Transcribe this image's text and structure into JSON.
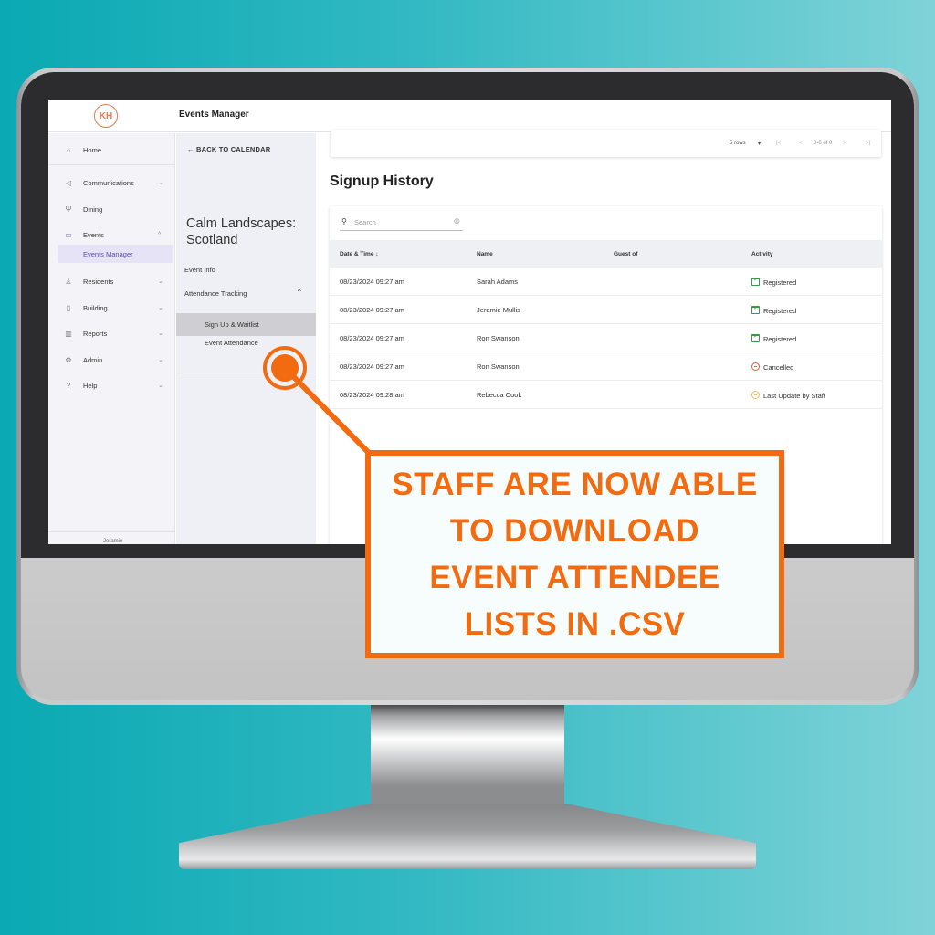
{
  "app": {
    "logo_text": "KH",
    "title": "Events Manager",
    "accent_color": "#5a4bb0",
    "logo_color": "#e47a4f"
  },
  "sidebar": {
    "items": [
      {
        "label": "Home",
        "icon": "home-icon",
        "glyph": "⌂",
        "chevron": ""
      },
      {
        "label": "Communications",
        "icon": "megaphone-icon",
        "glyph": "◁",
        "chevron": "⌄"
      },
      {
        "label": "Dining",
        "icon": "utensils-icon",
        "glyph": "Ψ",
        "chevron": ""
      },
      {
        "label": "Events",
        "icon": "calendar-icon",
        "glyph": "▭",
        "chevron": "^"
      },
      {
        "label": "Residents",
        "icon": "person-icon",
        "glyph": "♙",
        "chevron": "⌄"
      },
      {
        "label": "Building",
        "icon": "building-icon",
        "glyph": "▯",
        "chevron": "⌄"
      },
      {
        "label": "Reports",
        "icon": "bar-chart-icon",
        "glyph": "▥",
        "chevron": "⌄"
      },
      {
        "label": "Admin",
        "icon": "gear-icon",
        "glyph": "⚙",
        "chevron": "⌄"
      },
      {
        "label": "Help",
        "icon": "help-icon",
        "glyph": "?",
        "chevron": "⌄"
      }
    ],
    "sub_item": "Events Manager",
    "user_label": "Jeramie"
  },
  "subpanel": {
    "back_label": "← BACK TO CALENDAR",
    "event_title": "Calm Landscapes: Scotland",
    "event_info": "Event Info",
    "attendance_tracking": "Attendance Tracking",
    "attendance_chevron": "^",
    "signup_waitlist": "Sign Up & Waitlist",
    "event_attendance": "Event Attendance"
  },
  "pager": {
    "rows_label": "5 rows",
    "dropdown": "▾",
    "first": "|<",
    "prev": "<",
    "range": "0-0 of 0",
    "next": ">",
    "last": ">|"
  },
  "signup_history": {
    "title": "Signup History",
    "search_placeholder": "Search",
    "columns": [
      "Date & Time ↓",
      "Name",
      "Guest of",
      "Activity"
    ],
    "rows": [
      {
        "datetime": "08/23/2024 09:27 am",
        "name": "Sarah Adams",
        "guest_of": "",
        "activity": "Registered",
        "activity_type": "registered"
      },
      {
        "datetime": "08/23/2024 09:27 am",
        "name": "Jeramie Mullis",
        "guest_of": "",
        "activity": "Registered",
        "activity_type": "registered"
      },
      {
        "datetime": "08/23/2024 09:27 am",
        "name": "Ron Swanson",
        "guest_of": "",
        "activity": "Registered",
        "activity_type": "registered"
      },
      {
        "datetime": "08/23/2024 09:27 am",
        "name": "Ron Swanson",
        "guest_of": "",
        "activity": "Cancelled",
        "activity_type": "cancelled"
      },
      {
        "datetime": "08/23/2024 09:28 am",
        "name": "Rebecca Cook",
        "guest_of": "",
        "activity": "Last Update by Staff",
        "activity_type": "staff"
      }
    ]
  },
  "callout": {
    "lines": [
      "STAFF ARE NOW ABLE",
      "TO DOWNLOAD",
      "EVENT ATTENDEE",
      "LISTS IN .CSV"
    ],
    "color": "#f26b10"
  }
}
